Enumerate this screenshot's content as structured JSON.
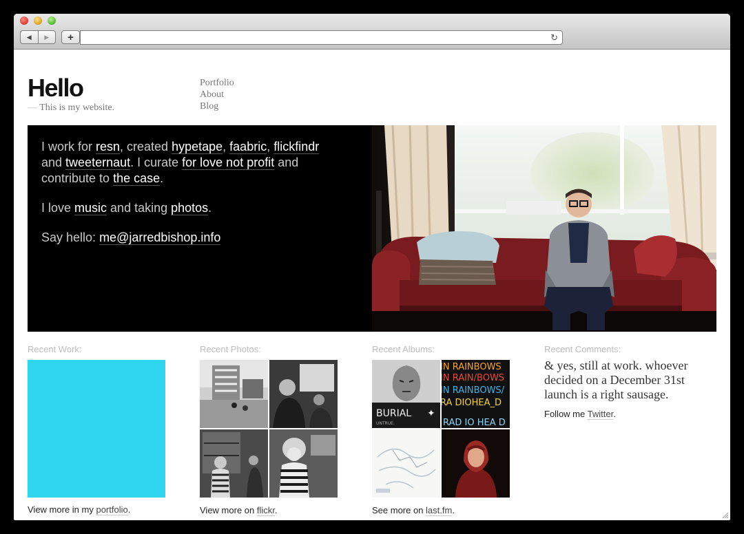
{
  "site": {
    "title": "Hello",
    "tagline_dash": "—",
    "tagline": "This is my website."
  },
  "nav": [
    "Portfolio",
    "About",
    "Blog"
  ],
  "intro": {
    "p1": {
      "t1": "I work for ",
      "resn": "resn",
      "t2": ", created ",
      "hypetape": "hypetape",
      "t3": ", ",
      "faabric": "faabric",
      "t4": ", ",
      "flickfindr": "flickfindr",
      "t5": " and ",
      "tweeternaut": "tweeternaut",
      "t6": ". I curate ",
      "flnp": "for love not profit",
      "t7": " and contribute to ",
      "thecase": "the case",
      "t8": "."
    },
    "p2": {
      "t1": "I love ",
      "music": "music",
      "t2": " and taking ",
      "photos": "photos",
      "t3": "."
    },
    "p3": {
      "t1": "Say hello: ",
      "email": "me@jarredbishop.info"
    }
  },
  "sections": {
    "work": {
      "label": "Recent Work:",
      "more_prefix": "View more in my ",
      "more_link": "portfolio",
      "more_suffix": ".",
      "tile_color": "#30d6f0"
    },
    "photos": {
      "label": "Recent Photos:",
      "more_prefix": "View more on ",
      "more_link": "flickr",
      "more_suffix": "."
    },
    "albums": {
      "label": "Recent Albums:",
      "more_prefix": "See more on ",
      "more_link": "last.fm",
      "more_suffix": ".",
      "burial_title": "BURIAL",
      "burial_sub": "UNTRUE.",
      "rainbows_lines": [
        "IN RAINBOWS",
        "IN RAIN/BOWS",
        "IN RAINBOWS/",
        "RA DIOHEA_D",
        "RAD IO HEA D"
      ]
    },
    "comments": {
      "label": "Recent Comments:",
      "text": "& yes, still at work. whoever decided on a December 31st launch is a right sausage.",
      "follow_prefix": "Follow me ",
      "follow_link": "Twitter",
      "follow_suffix": "."
    }
  },
  "colors": {
    "accent": "#30d6f0",
    "hero_bg": "#000000",
    "sofa": "#8a1f22"
  }
}
